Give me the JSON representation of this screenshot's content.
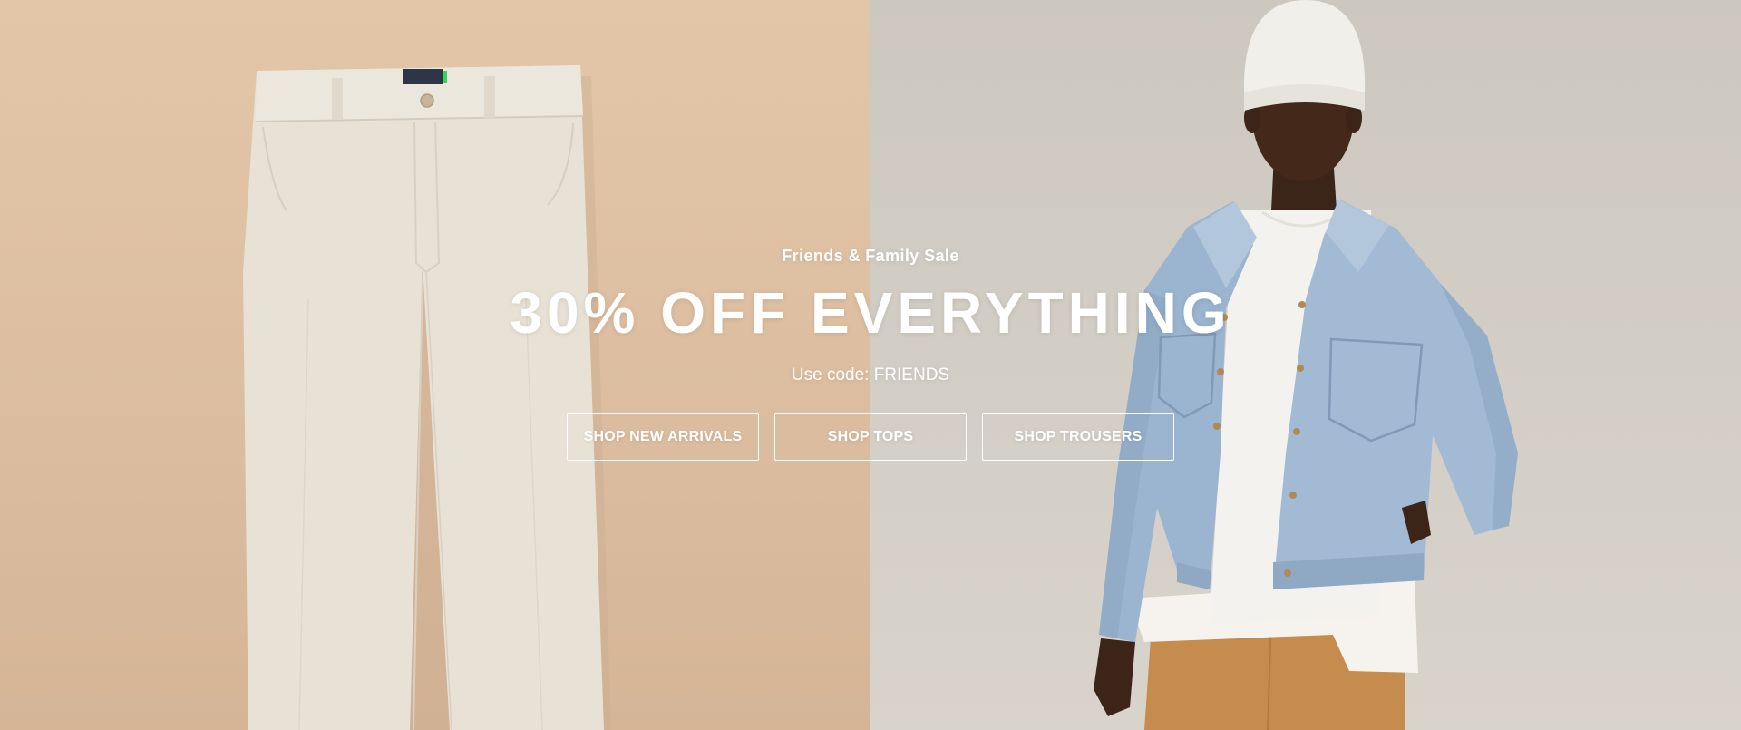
{
  "hero": {
    "eyebrow": "Friends & Family Sale",
    "headline": "30% OFF EVERYTHING",
    "promo": "Use code: FRIENDS",
    "buttons": [
      {
        "label": "SHOP NEW ARRIVALS"
      },
      {
        "label": "SHOP TOPS"
      },
      {
        "label": "SHOP TROUSERS"
      }
    ],
    "images": {
      "left": "cream chino trousers flat lay on tan background",
      "right": "model wearing white beanie, denim jacket, white tee and khaki trousers"
    }
  },
  "colors": {
    "left_background": "#ddbfa1",
    "right_background": "#d1ccc4",
    "text": "#ffffff",
    "button_border": "#ffffff"
  }
}
